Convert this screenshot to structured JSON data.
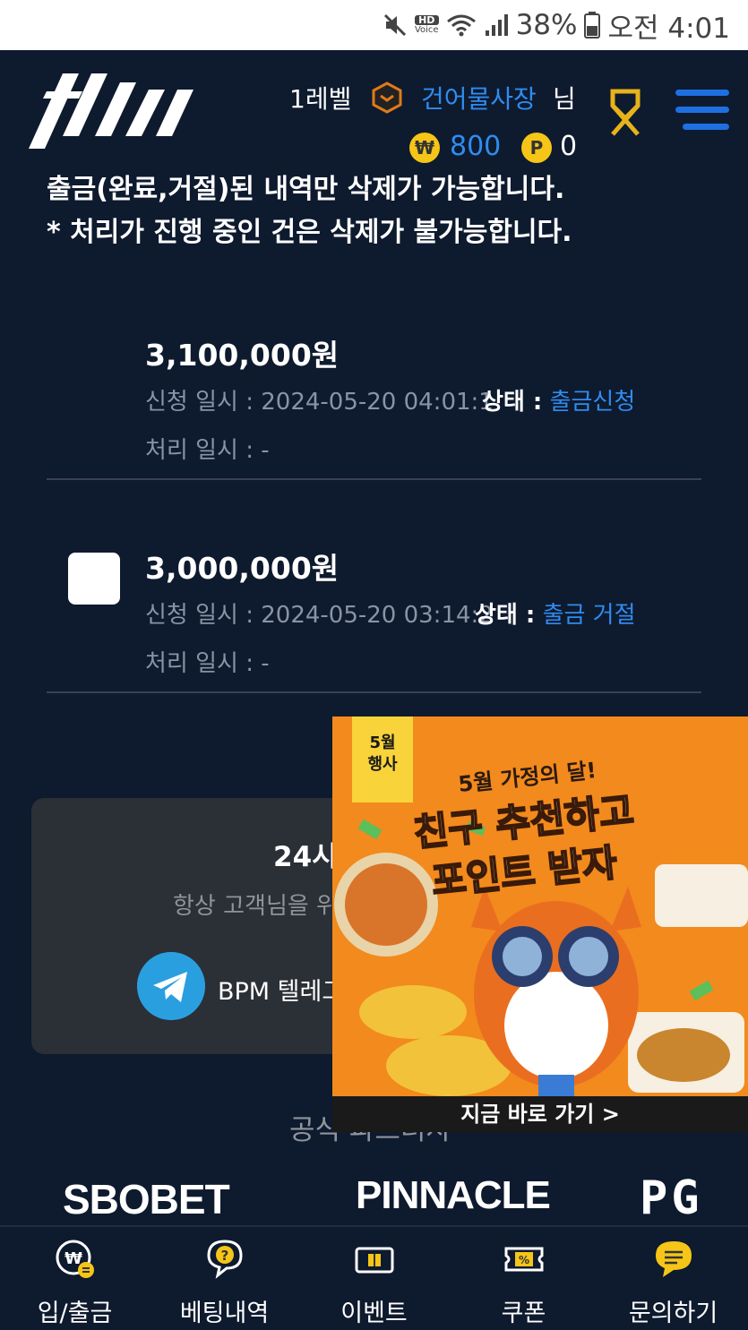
{
  "status_bar": {
    "battery": "38%",
    "time": "오전 4:01",
    "hd_voice": [
      "HD",
      "Voice"
    ]
  },
  "header": {
    "level": "1레벨",
    "username": "건어물사장",
    "honorific": "님",
    "money": "800",
    "points": "0",
    "money_symbol": "₩",
    "points_symbol": "P"
  },
  "notices": [
    "출금(완료,거절)된 내역만 삭제가 가능합니다.",
    "* 처리가 진행 중인 건은 삭제가 불가능합니다."
  ],
  "records": [
    {
      "amount": "3,100,000원",
      "request_label": "신청 일시 : 2024-05-20 04:01:1",
      "status_label": "상태 :",
      "status_value": "출금신청",
      "processed_label": "처리 일시 : -"
    },
    {
      "amount": "3,000,000원",
      "request_label": "신청 일시 : 2024-05-20 03:14:2",
      "status_label": "상태 :",
      "status_value": "출금 거절",
      "processed_label": "처리 일시 : -"
    }
  ],
  "support": {
    "title": "24시",
    "subtitle": "항상 고객님을 위",
    "telegram_label": "BPM 텔레그"
  },
  "partners": {
    "title": "공식 파트너사",
    "logos": [
      "SBOBET",
      "PINNACLE",
      "PG"
    ]
  },
  "ad": {
    "tag": [
      "5월",
      "행사"
    ],
    "subtitle": "5월 가정의 달!",
    "headline1": "친구 추천하고",
    "headline2": "포인트 받자",
    "cta": "지금 바로 가기 >"
  },
  "bottom_nav": [
    {
      "label": "입/출금",
      "icon": "deposit-withdraw-icon"
    },
    {
      "label": "베팅내역",
      "icon": "betting-history-icon"
    },
    {
      "label": "이벤트",
      "icon": "event-gift-icon"
    },
    {
      "label": "쿠폰",
      "icon": "coupon-icon"
    },
    {
      "label": "문의하기",
      "icon": "inquiry-chat-icon"
    }
  ],
  "colors": {
    "background": "#0e1a2e",
    "accent_blue": "#2f8cf0",
    "coin_gold": "#f5c518",
    "ad_orange": "#f28a1d"
  }
}
